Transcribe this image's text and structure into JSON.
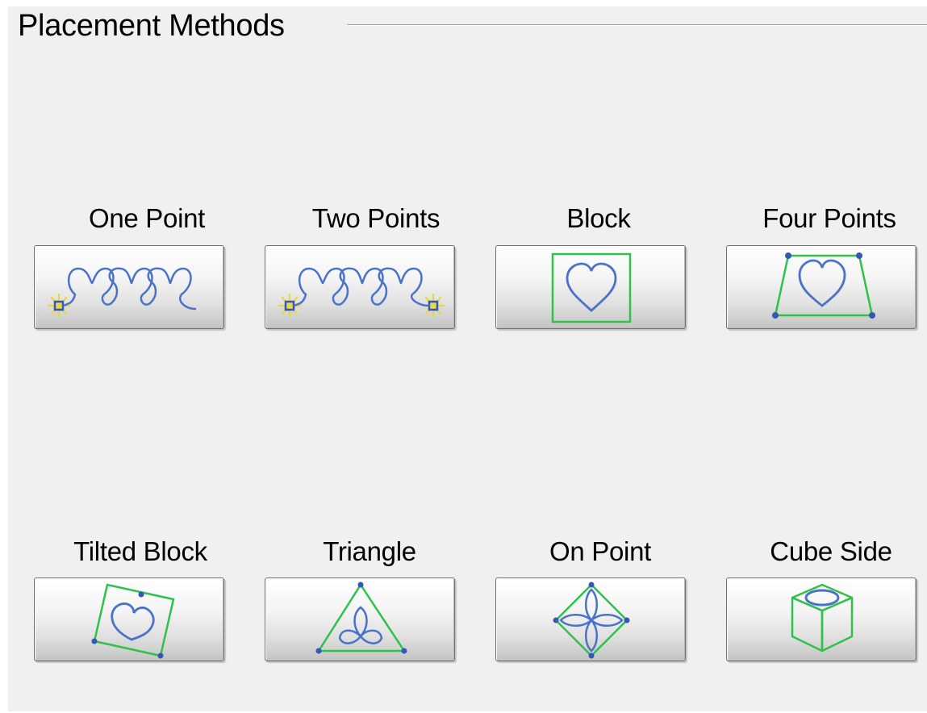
{
  "group": {
    "title": "Placement Methods"
  },
  "buttons": [
    {
      "label": "One Point",
      "icon": "one-point-icon"
    },
    {
      "label": "Two Points",
      "icon": "two-points-icon"
    },
    {
      "label": "Block",
      "icon": "block-icon"
    },
    {
      "label": "Four Points",
      "icon": "four-points-icon"
    },
    {
      "label": "Tilted Block",
      "icon": "tilted-block-icon"
    },
    {
      "label": "Triangle",
      "icon": "triangle-icon"
    },
    {
      "label": "On Point",
      "icon": "on-point-icon"
    },
    {
      "label": "Cube Side",
      "icon": "cube-side-icon"
    }
  ],
  "colors": {
    "pattern": "#4a72c8",
    "guide": "#2fc24a",
    "anchor": "#3358b8",
    "star": "#e8d84a"
  }
}
